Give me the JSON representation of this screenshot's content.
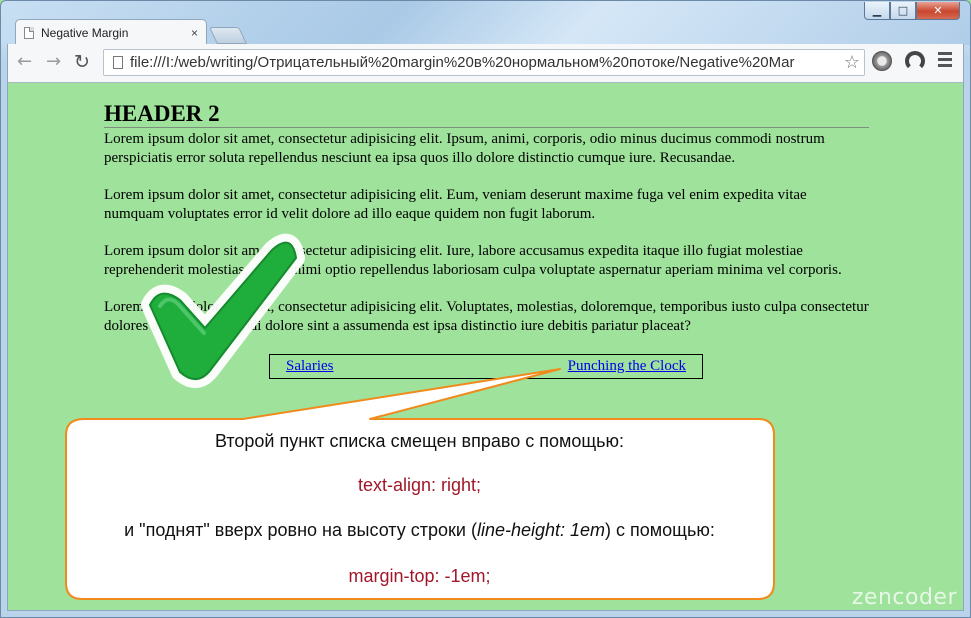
{
  "browser": {
    "tab_title": "Negative Margin",
    "tab_close": "×",
    "url": "file:///I:/web/writing/Отрицательный%20margin%20в%20нормальном%20потоке/Negative%20Mar",
    "window_controls": {
      "minimize": "▁",
      "maximize": "□",
      "close": "✕"
    },
    "icons": {
      "back": "←",
      "forward": "→",
      "reload": "↻",
      "star": "☆"
    }
  },
  "page": {
    "heading": "HEADER 2",
    "paragraphs": [
      "Lorem ipsum dolor sit amet, consectetur adipisicing elit. Ipsum, animi, corporis, odio minus ducimus commodi nostrum perspiciatis error soluta repellendus nesciunt ea ipsa quos illo dolore distinctio cumque iure. Recusandae.",
      "Lorem ipsum dolor sit amet, consectetur adipisicing elit. Eum, veniam deserunt maxime fuga vel enim expedita vitae numquam voluptates error id velit dolore ad illo eaque quidem non fugit laborum.",
      "Lorem ipsum dolor sit amet, consectetur adipisicing elit. Iure, labore accusamus expedita itaque illo fugiat molestiae reprehenderit molestias, sequi animi optio repellendus laboriosam culpa voluptate aspernatur aperiam minima vel corporis.",
      "Lorem ipsum dolor sit amet, consectetur adipisicing elit. Voluptates, molestias, doloremque, temporibus iusto culpa consectetur dolores accusantium modi dolore sint a assumenda est ipsa distinctio iure debitis pariatur placeat?"
    ],
    "nav_items": [
      "Salaries",
      "Punching the Clock"
    ]
  },
  "callout": {
    "line1": "Второй пункт списка смещен вправо с помощью:",
    "code1": "text-align: right;",
    "line2_pre": "и \"поднят\" вверх ровно на высоту строки (",
    "line2_em": "line-height: 1em",
    "line2_post": ") с помощью:",
    "code2": "margin-top: -1em;"
  },
  "watermark": "zencoder",
  "colors": {
    "page_background": "#9ee29b",
    "link": "#0000ee",
    "callout_border": "#f08a1c",
    "callout_code": "#a1172a",
    "checkmark_green": "#1fad3c"
  }
}
